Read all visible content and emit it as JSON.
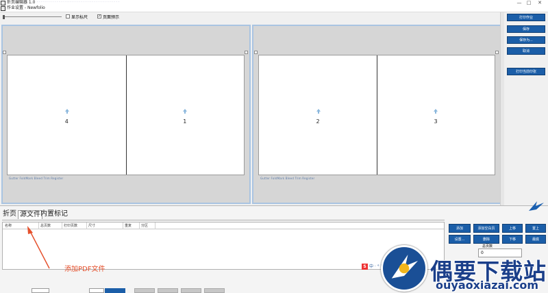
{
  "window": {
    "title_prefix": "折页编辑器 1.0",
    "title_blurred": "··········································",
    "subtitle": "作业设置 - Newfolio",
    "controls": {
      "minimize": "—",
      "maximize": "□",
      "close": "✕"
    }
  },
  "toolbar": {
    "show_ruler_label": "显示标尺",
    "show_ruler_checked": false,
    "preview_label": "页面预示",
    "preview_checked": true
  },
  "sheets": [
    {
      "pages": [
        "4",
        "1"
      ],
      "marks": "Gutter   FoldMark   Bleed   Trim   Register"
    },
    {
      "pages": [
        "2",
        "3"
      ],
      "marks": "Gutter   FoldMark   Bleed   Trim   Register"
    }
  ],
  "side_buttons": {
    "print_job": "打印作业",
    "save": "保存",
    "save_as": "保存为...",
    "cancel": "取消",
    "print_current": "打印当前印张"
  },
  "tabs": {
    "fold": "折页",
    "source": "源文件",
    "marks": "内置标记"
  },
  "table": {
    "columns": [
      "名称",
      "总页数",
      "打印页数",
      "尺寸",
      "重复",
      "分区"
    ]
  },
  "list_buttons": {
    "add": "添加",
    "add_blank": "添加空白页",
    "move_up": "上移",
    "top": "置上",
    "settings": "设置...",
    "delete": "删除",
    "move_down": "下移",
    "bottom": "最底"
  },
  "page_count": {
    "label": "总页数",
    "value": "0"
  },
  "annotation": {
    "text": "添加PDF文件"
  },
  "ime": {
    "logo": "S",
    "text": "中 · ° 囲 ♣ 👕 ⌖"
  },
  "watermark": {
    "title": "偶要下载站",
    "url": "ouyaoxiazai.com"
  },
  "colors": {
    "accent": "#1b5ea8",
    "annotation": "#e5512d",
    "panel_border": "#a9c4e2"
  }
}
